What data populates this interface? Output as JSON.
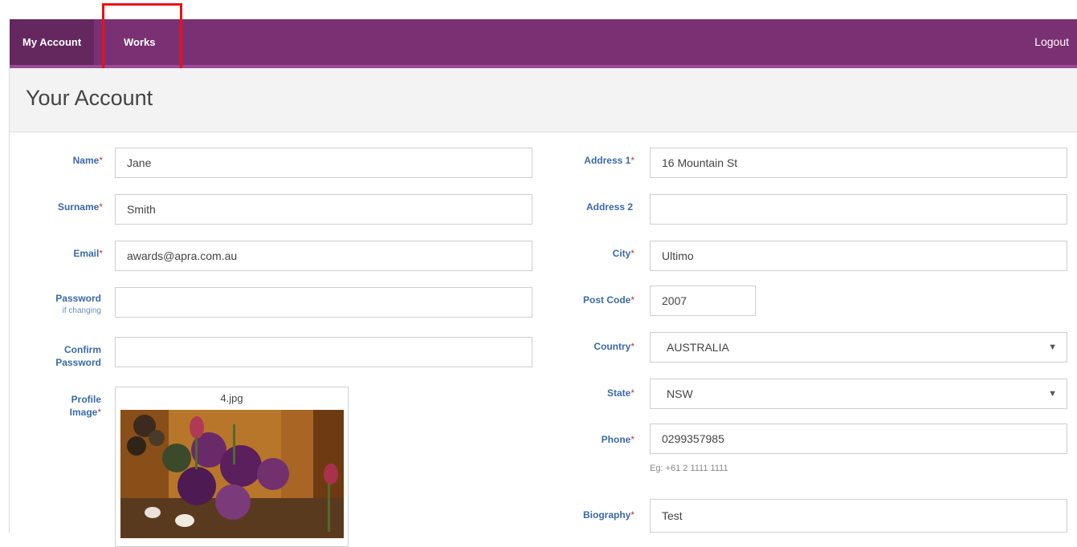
{
  "nav": {
    "my_account": "My Account",
    "works": "Works",
    "logout": "Logout"
  },
  "page": {
    "title": "Your Account"
  },
  "form": {
    "name": {
      "label": "Name",
      "value": "Jane"
    },
    "surname": {
      "label": "Surname",
      "value": "Smith"
    },
    "email": {
      "label": "Email",
      "value": "awards@apra.com.au"
    },
    "password": {
      "label": "Password",
      "sublabel": "if changing",
      "value": ""
    },
    "confirm_password": {
      "label_line1": "Confirm",
      "label_line2": "Password",
      "value": ""
    },
    "profile_image": {
      "label_line1": "Profile",
      "label_line2": "Image",
      "filename": "4.jpg"
    },
    "address1": {
      "label": "Address 1",
      "value": "16 Mountain St"
    },
    "address2": {
      "label": "Address 2",
      "value": ""
    },
    "city": {
      "label": "City",
      "value": "Ultimo"
    },
    "post_code": {
      "label": "Post Code",
      "value": "2007"
    },
    "country": {
      "label": "Country",
      "value": "AUSTRALIA"
    },
    "state": {
      "label": "State",
      "value": "NSW"
    },
    "phone": {
      "label": "Phone",
      "value": "0299357985",
      "hint": "Eg: +61 2 1111 1111"
    },
    "biography": {
      "label": "Biography",
      "value": "Test"
    },
    "required_mark": "*"
  },
  "colors": {
    "nav_bg": "#7a3173",
    "nav_active": "#64285f",
    "label": "#3a6aa8",
    "highlight": "#e11111"
  }
}
